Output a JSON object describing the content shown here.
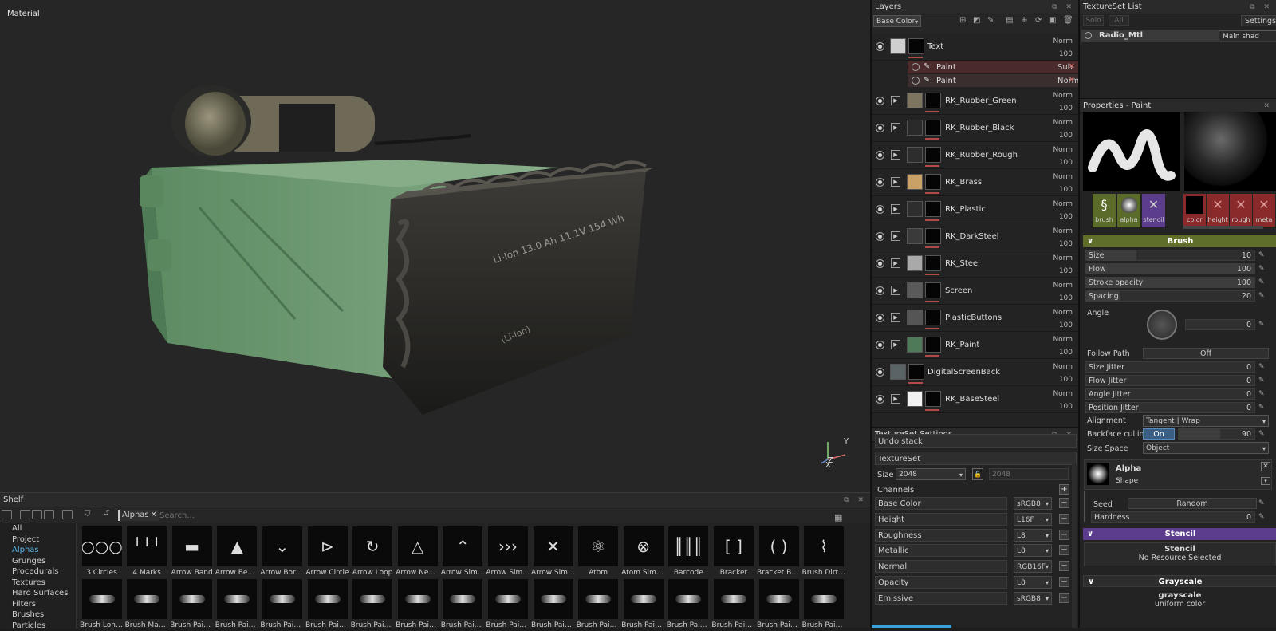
{
  "viewport": {
    "label": "Material",
    "axis_y": "Y",
    "axis_z": "Z",
    "axis_x": "X"
  },
  "shelf": {
    "title": "Shelf",
    "filter_chip": "Alphas",
    "search_placeholder": "Search...",
    "categories": [
      "All",
      "Project",
      "Alphas",
      "Grunges",
      "Procedurals",
      "Textures",
      "Hard Surfaces",
      "Filters",
      "Brushes",
      "Particles"
    ],
    "row1": [
      "3 Circles",
      "4 Marks",
      "Arrow Band",
      "Arrow Bend ...",
      "Arrow Borde...",
      "Arrow Circle",
      "Arrow Loop",
      "Arrow Negat...",
      "Arrow Simple",
      "Arrow Simpl...",
      "Arrow Simpl...",
      "Atom",
      "Atom Simple",
      "Barcode",
      "Bracket",
      "Bracket Ben...",
      "Brush Dirty ..."
    ],
    "row2": [
      "Brush Long ...",
      "Brush Maker",
      "Brush Paint ...",
      "Brush Paint ...",
      "Brush Paint ...",
      "Brush Paint ...",
      "Brush Paint ...",
      "Brush Paint ...",
      "Brush Paint ...",
      "Brush Paint ...",
      "Brush Paint ...",
      "Brush Paint ...",
      "Brush Paint ...",
      "Brush Paint ...",
      "Brush Paint ...",
      "Brush Paint ...",
      "Brush Paint ..."
    ],
    "row1_glyphs": [
      "○○○",
      "╵╵╵",
      "▬",
      "▲",
      "⌄",
      "⊳",
      "↻",
      "△",
      "⌃",
      "›››",
      "✕",
      "⚛",
      "⊗",
      "║║║",
      "[ ]",
      "( )",
      "⌇"
    ]
  },
  "layers": {
    "title": "Layers",
    "channel": "Base Color",
    "items": [
      {
        "name": "Text",
        "blend": "Norm",
        "opacity": "100",
        "swatch": "#cfcfcf",
        "folder": false
      },
      {
        "name": "RK_Rubber_Green",
        "blend": "Norm",
        "opacity": "100",
        "swatch": "#7d7560",
        "folder": true
      },
      {
        "name": "RK_Rubber_Black",
        "blend": "Norm",
        "opacity": "100",
        "swatch": "#2a2a2a",
        "folder": true
      },
      {
        "name": "RK_Rubber_Rough",
        "blend": "Norm",
        "opacity": "100",
        "swatch": "#2d2d2d",
        "folder": true
      },
      {
        "name": "RK_Brass",
        "blend": "Norm",
        "opacity": "100",
        "swatch": "#c9a066",
        "folder": true
      },
      {
        "name": "RK_Plastic",
        "blend": "Norm",
        "opacity": "100",
        "swatch": "#2e2e2e",
        "folder": true
      },
      {
        "name": "RK_DarkSteel",
        "blend": "Norm",
        "opacity": "100",
        "swatch": "#3a3a3a",
        "folder": true
      },
      {
        "name": "RK_Steel",
        "blend": "Norm",
        "opacity": "100",
        "swatch": "#a9a9a9",
        "folder": true
      },
      {
        "name": "Screen",
        "blend": "Norm",
        "opacity": "100",
        "swatch": "#5a5a5a",
        "folder": true
      },
      {
        "name": "PlasticButtons",
        "blend": "Norm",
        "opacity": "100",
        "swatch": "#555555",
        "folder": true
      },
      {
        "name": "RK_Paint",
        "blend": "Norm",
        "opacity": "100",
        "swatch": "#4e7a5a",
        "folder": true
      },
      {
        "name": "DigitalScreenBack",
        "blend": "Norm",
        "opacity": "100",
        "swatch": "#5a6466",
        "folder": false
      },
      {
        "name": "RK_BaseSteel",
        "blend": "Norm",
        "opacity": "100",
        "swatch": "#f2f2f2",
        "folder": true
      }
    ],
    "effects": [
      {
        "name": "Paint",
        "blend": "Sub",
        "opacity": "100"
      },
      {
        "name": "Paint",
        "blend": "Norm",
        "opacity": "100"
      }
    ]
  },
  "textureset_settings": {
    "title": "TextureSet Settings",
    "undo_stack": "Undo stack",
    "textureset": "TextureSet",
    "size_label": "Size",
    "size_value": "2048",
    "size_value2": "2048",
    "channels_label": "Channels",
    "channels": [
      {
        "name": "Base Color",
        "format": "sRGB8"
      },
      {
        "name": "Height",
        "format": "L16F"
      },
      {
        "name": "Roughness",
        "format": "L8"
      },
      {
        "name": "Metallic",
        "format": "L8"
      },
      {
        "name": "Normal",
        "format": "RGB16F"
      },
      {
        "name": "Opacity",
        "format": "L8"
      },
      {
        "name": "Emissive",
        "format": "sRGB8"
      }
    ]
  },
  "textureset_list": {
    "title": "TextureSet List",
    "solo": "Solo",
    "all": "All",
    "settings": "Settings",
    "item": "Radio_Mtl",
    "shader": "Main shad"
  },
  "properties": {
    "title": "Properties - Paint",
    "slots": [
      "brush",
      "alpha",
      "stencil"
    ],
    "channels": [
      "color",
      "height",
      "rough",
      "meta"
    ],
    "brush_section": "Brush",
    "size_label": "Size",
    "size_value": "10",
    "flow_label": "Flow",
    "flow_value": "100",
    "stroke_opacity_label": "Stroke opacity",
    "stroke_opacity_value": "100",
    "spacing_label": "Spacing",
    "spacing_value": "20",
    "angle_label": "Angle",
    "angle_value": "0",
    "follow_path_label": "Follow Path",
    "follow_path_value": "Off",
    "size_jitter_label": "Size Jitter",
    "size_jitter_value": "0",
    "flow_jitter_label": "Flow Jitter",
    "flow_jitter_value": "0",
    "angle_jitter_label": "Angle Jitter",
    "angle_jitter_value": "0",
    "position_jitter_label": "Position Jitter",
    "position_jitter_value": "0",
    "alignment_label": "Alignment",
    "alignment_value": "Tangent | Wrap",
    "backface_label": "Backface culling",
    "backface_toggle": "On",
    "backface_value": "90",
    "size_space_label": "Size Space",
    "size_space_value": "Object",
    "alpha_title": "Alpha",
    "alpha_sub": "Shape",
    "seed_label": "Seed",
    "seed_value": "Random",
    "hardness_label": "Hardness",
    "hardness_value": "0",
    "stencil_section": "Stencil",
    "stencil_title": "Stencil",
    "stencil_sub": "No Resource Selected",
    "grayscale_section": "Grayscale",
    "grayscale_title": "grayscale",
    "grayscale_sub": "uniform color"
  },
  "colors": {
    "accent_blue": "#5ab4e6",
    "brush_green": "#5f6f2a",
    "stencil_purple": "#5c3c8c",
    "effect_red": "#4a2a2a"
  }
}
